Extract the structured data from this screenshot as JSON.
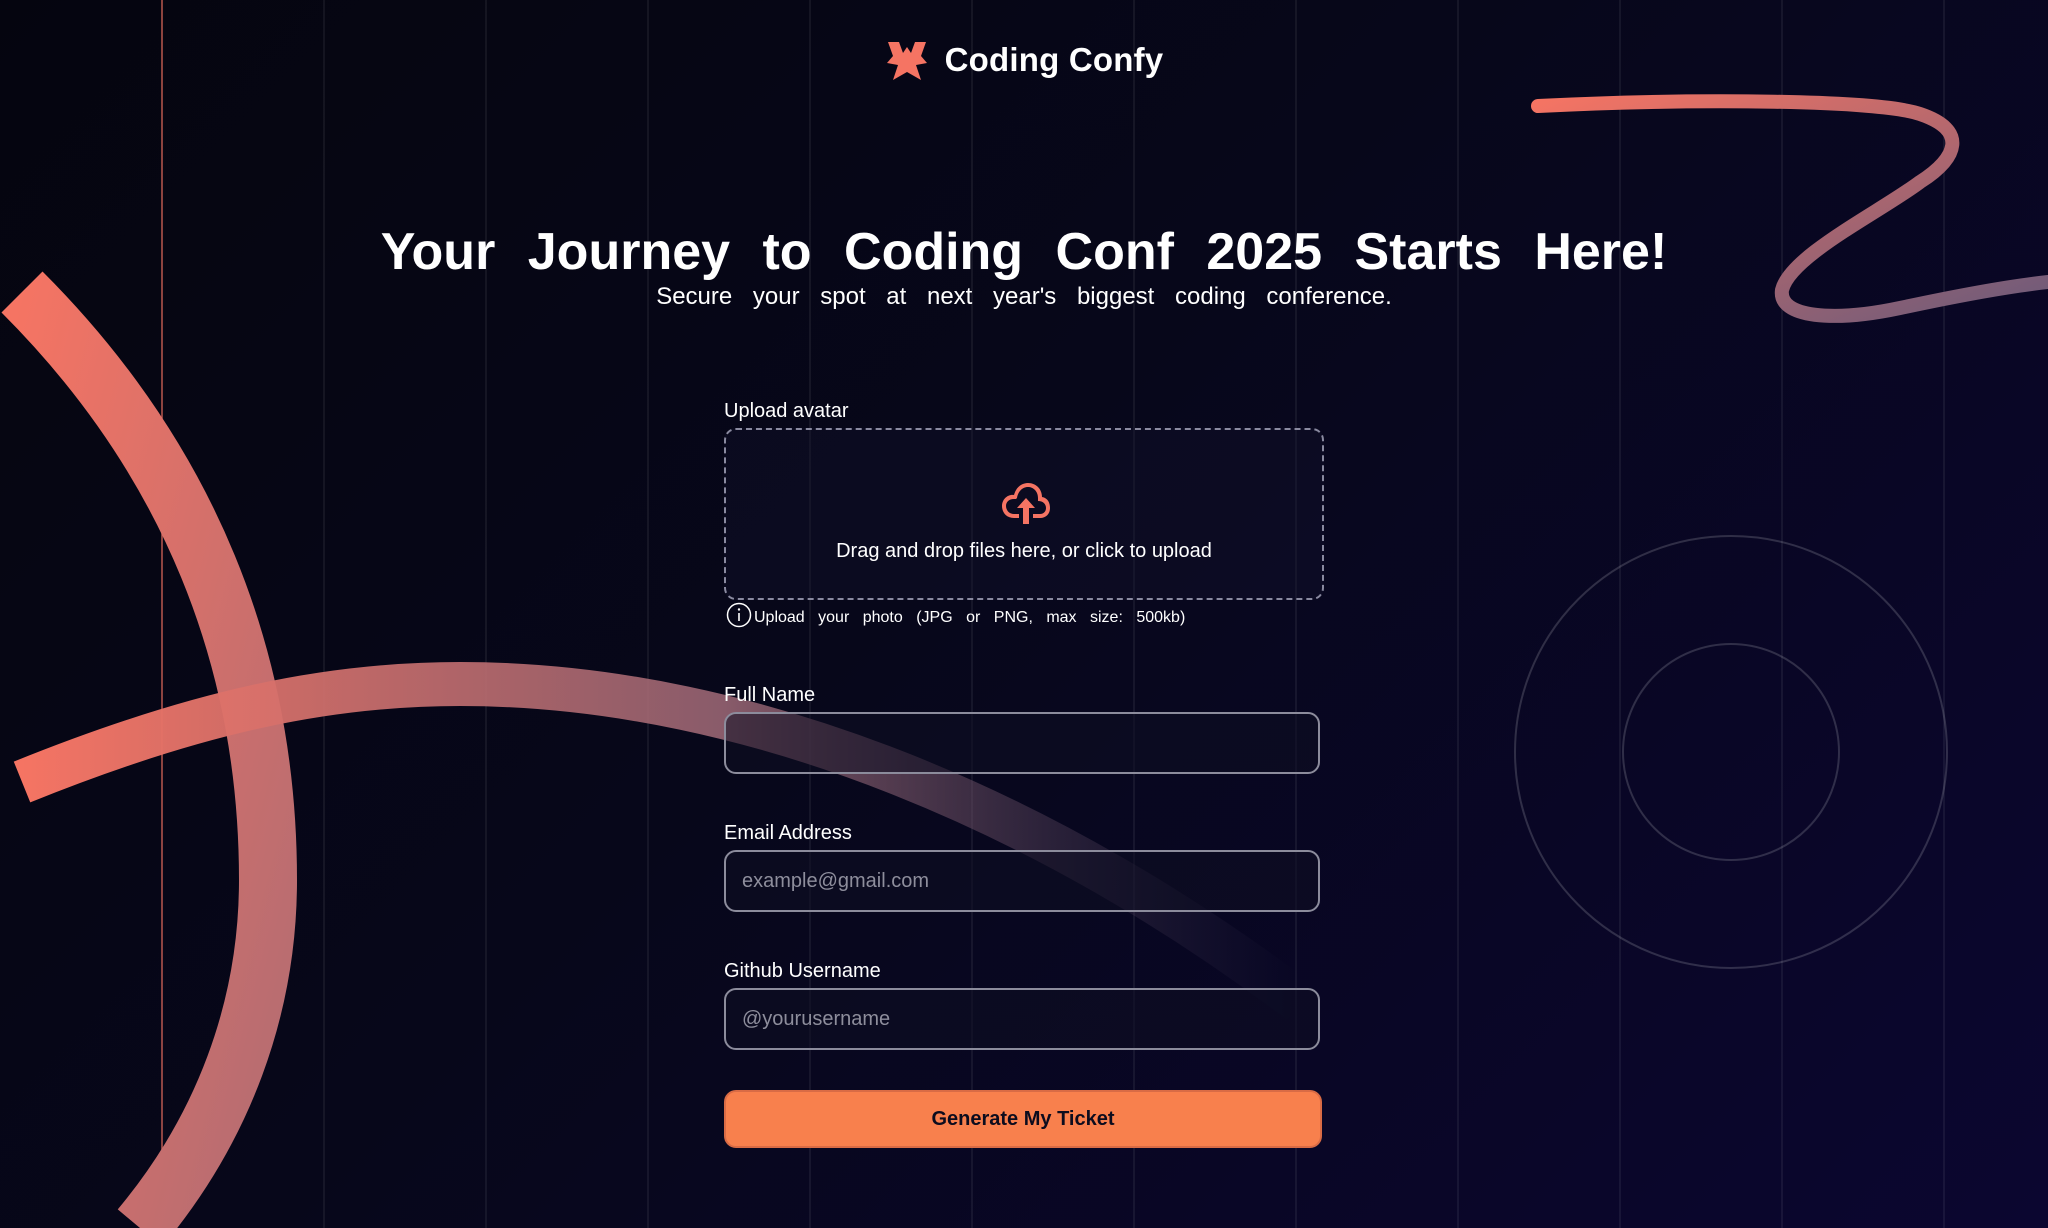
{
  "brand": {
    "name": "Coding Confy",
    "logo_icon": "coding-confy-logo-icon",
    "accent_color": "#f57463"
  },
  "hero": {
    "title": "Your Journey to Coding Conf 2025 Starts Here!",
    "subtitle": "Secure your spot at next year's biggest coding conference."
  },
  "form": {
    "avatar": {
      "label": "Upload avatar",
      "icon": "cloud-upload-icon",
      "dropzone_text": "Drag and drop files here, or click to upload",
      "hint_icon": "info-icon",
      "hint": "Upload your photo (JPG or PNG, max size: 500kb)"
    },
    "full_name": {
      "label": "Full Name",
      "value": "",
      "placeholder": ""
    },
    "email": {
      "label": "Email Address",
      "value": "",
      "placeholder": "example@gmail.com"
    },
    "github": {
      "label": "Github Username",
      "value": "",
      "placeholder": "@yourusername"
    },
    "submit_label": "Generate My Ticket",
    "submit_color": "#f8804d"
  },
  "colors": {
    "background": "#05050f",
    "text": "#ffffff",
    "border": "#8c8c9c"
  }
}
